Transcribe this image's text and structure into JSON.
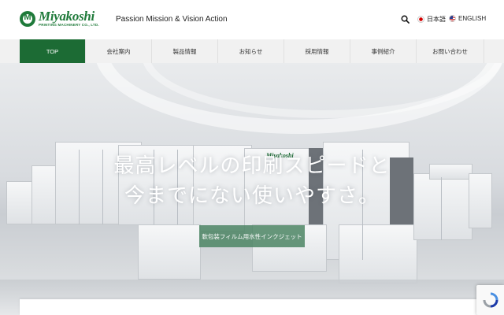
{
  "header": {
    "logo_word": "Miyakoshi",
    "logo_sub": "PRINTING MACHINERY CO., LTD.",
    "tagline": "Passion Mission & Vision Action",
    "search_icon": "search-icon",
    "languages": [
      {
        "label": "日本語",
        "flag": "jp-flag-icon"
      },
      {
        "label": "ENGLISH",
        "flag": "us-flag-icon"
      }
    ]
  },
  "nav": {
    "items": [
      {
        "label": "TOP",
        "active": true
      },
      {
        "label": "会社案内",
        "active": false
      },
      {
        "label": "製品情報",
        "active": false
      },
      {
        "label": "お知らせ",
        "active": false
      },
      {
        "label": "採用情報",
        "active": false
      },
      {
        "label": "事例紹介",
        "active": false
      },
      {
        "label": "お問い合わせ",
        "active": false
      }
    ]
  },
  "hero": {
    "title_line1": "最高レベルの印刷スピードと",
    "title_line2": "今までにない使いやすさ。",
    "button_label": "軟包装フィルム用水性インクジェット",
    "machine_brand": "Miyakoshi"
  },
  "colors": {
    "brand_green": "#1c6b34",
    "nav_bg": "#f1f1f1",
    "button_green": "#4c8564"
  }
}
